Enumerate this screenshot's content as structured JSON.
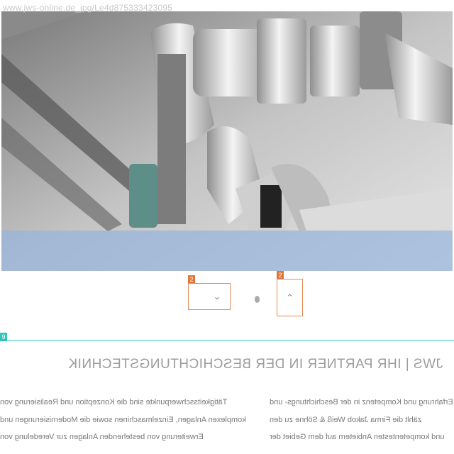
{
  "watermark": "www.jws-online.de_jpg/Le4d875333423095",
  "hero": {
    "image_description": "Close-up photo of metal pipe fittings and nuts"
  },
  "carousel": {
    "prev_badge": "2",
    "next_badge": "2",
    "prev_icon": "chevron-down-icon",
    "next_icon": "chevron-up-icon"
  },
  "section": {
    "badge": "9",
    "title": "JWS | IHR PARTNER IN DER BESCHICHTUNGSTECHNIK",
    "left_lines": [
      "Tätigkeitsschwerpunkte sind die Konzeption und Realisierung von",
      "komplexen Anlagen, Einzelmaschinen sowie die Modernisierungen und",
      "Erweiterung von bestehenden Anlagen zur Veredelung von"
    ],
    "right_lines": [
      "Mit Erfahrung und Kompetenz in der Beschichtungs- und",
      "zählt die Firma Jakob Weiß & Söhne zu den",
      "und kompetentesten Anbietern auf dem Gebiet der"
    ]
  },
  "colors": {
    "band": "#96b4dc",
    "accent_orange": "#e38a52",
    "accent_teal": "#2ec4b8"
  }
}
